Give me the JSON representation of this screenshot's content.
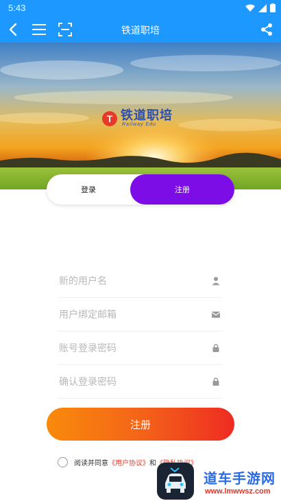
{
  "status_bar": {
    "time": "5:43"
  },
  "app_bar": {
    "title": "铁道职培"
  },
  "banner": {
    "logo_cn": "铁道职培",
    "logo_en": "Railway Edu",
    "logo_mark": "T"
  },
  "tabs": [
    {
      "label": "登录"
    },
    {
      "label": "注册"
    }
  ],
  "active_tab": "注册",
  "form": {
    "fields": [
      {
        "placeholder": "新的用户名",
        "value": "",
        "icon": "person-icon"
      },
      {
        "placeholder": "用户绑定邮箱",
        "value": "",
        "icon": "mail-icon"
      },
      {
        "placeholder": "账号登录密码",
        "value": "",
        "icon": "lock-icon"
      },
      {
        "placeholder": "确认登录密码",
        "value": "",
        "icon": "lock-icon"
      }
    ],
    "submit_label": "注册"
  },
  "agreement": {
    "prefix": "阅读并同意",
    "link1": "《用户协议》",
    "conjunction": "和",
    "link2": "《隐私协议》"
  },
  "watermark": {
    "title": "道车手游网",
    "url": "www.lmwwsz.com"
  },
  "colors": {
    "primary": "#1c98ff",
    "tab_active": "#7d0de6",
    "button_start": "#f98a0c",
    "button_end": "#ee2b22",
    "link": "#e53b2a"
  }
}
